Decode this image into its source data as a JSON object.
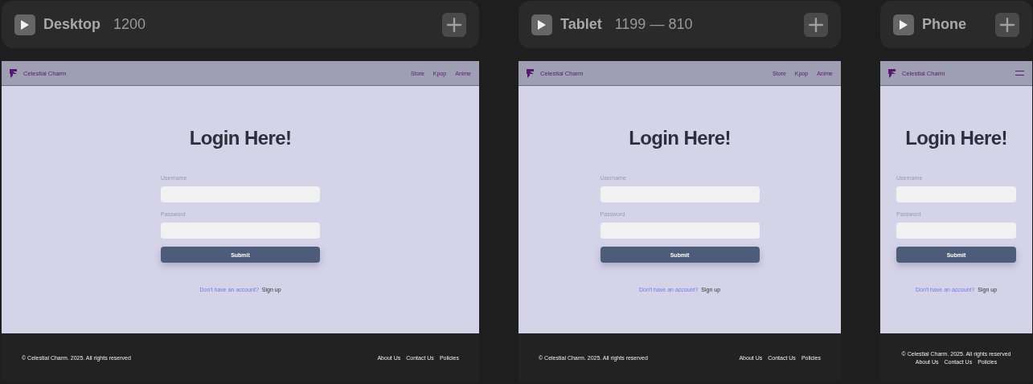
{
  "frames": [
    {
      "kind": "wide",
      "label": "Desktop",
      "size": "1200",
      "site": {
        "brand": "Celestial Charm",
        "nav_links": [
          "Store",
          "Kpop",
          "Anime"
        ],
        "heading": "Login Here!",
        "fields": [
          {
            "label": "Username"
          },
          {
            "label": "Password"
          }
        ],
        "submit": "Submit",
        "signup_prompt": "Don't have an account?",
        "signup_link": "Sign up",
        "copyright": "© Celestial Charm. 2025. All rights reserved",
        "footer_links": [
          "About Us",
          "Contact Us",
          "Policies"
        ]
      }
    },
    {
      "kind": "wide",
      "label": "Tablet",
      "size": "1199 — 810",
      "site": {
        "brand": "Celestial Charm",
        "nav_links": [
          "Store",
          "Kpop",
          "Anime"
        ],
        "heading": "Login Here!",
        "fields": [
          {
            "label": "Username"
          },
          {
            "label": "Password"
          }
        ],
        "submit": "Submit",
        "signup_prompt": "Don't have an account?",
        "signup_link": "Sign up",
        "copyright": "© Celestial Charm. 2025. All rights reserved",
        "footer_links": [
          "About Us",
          "Contact Us",
          "Policies"
        ]
      }
    },
    {
      "kind": "narrow",
      "label": "Phone",
      "site": {
        "brand": "Celestial Charm",
        "heading": "Login Here!",
        "fields": [
          {
            "label": "Username"
          },
          {
            "label": "Password"
          }
        ],
        "submit": "Submit",
        "signup_prompt": "Don't have an account?",
        "signup_link": "Sign up",
        "copyright": "© Celestial Charm. 2025. All rights reserved",
        "footer_links": [
          "About Us",
          "Contact Us",
          "Policies"
        ]
      }
    }
  ]
}
